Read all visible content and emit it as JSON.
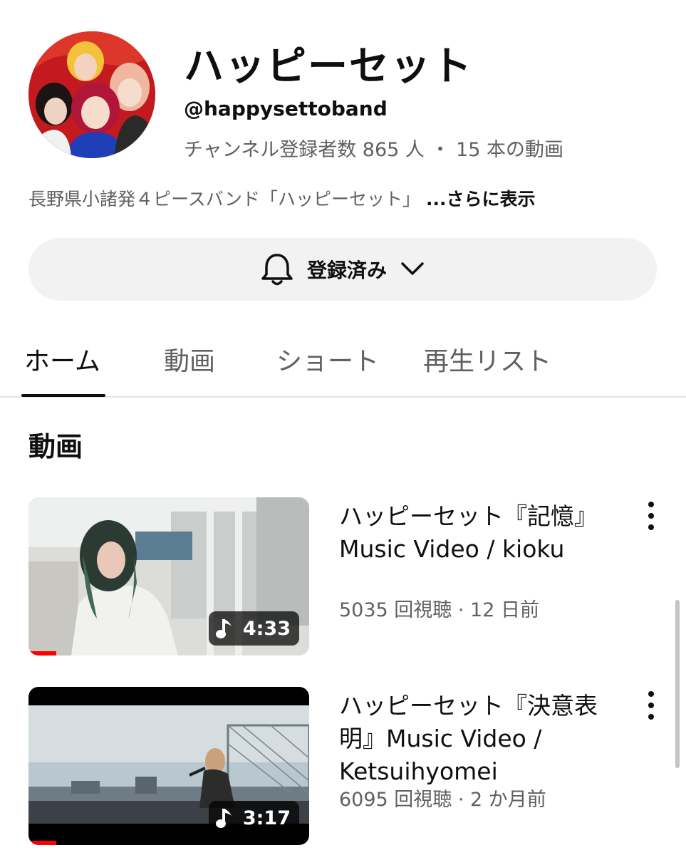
{
  "channel": {
    "name": "ハッピーセット",
    "handle": "@happysettoband",
    "stats": "チャンネル登録者数 865 人 ・ 15 本の動画",
    "description": "長野県小諸発４ピースバンド「ハッピーセット」",
    "more_label": "...さらに表示"
  },
  "subscribe": {
    "label": "登録済み",
    "icon": "bell-icon",
    "dropdown_icon": "chevron-down-icon"
  },
  "tabs": [
    {
      "label": "ホーム",
      "active": true
    },
    {
      "label": "動画",
      "active": false
    },
    {
      "label": "ショート",
      "active": false
    },
    {
      "label": "再生リスト",
      "active": false
    }
  ],
  "section": {
    "title": "動画"
  },
  "videos": [
    {
      "title": "ハッピーセット『記憶』Music Video / kioku",
      "meta": "5035 回視聴 · 12 日前",
      "duration": "4:33",
      "watched_fraction": 0.1,
      "icon": "music-note-icon"
    },
    {
      "title": "ハッピーセット『決意表明』Music Video / Ketsuihyomei",
      "meta": "6095 回視聴 · 2 か月前",
      "duration": "3:17",
      "watched_fraction": 0.1,
      "icon": "music-note-icon"
    }
  ],
  "colors": {
    "accent": "#ff0000",
    "text_primary": "#0f0f0f",
    "text_secondary": "#606060",
    "button_bg": "#f2f2f2"
  }
}
